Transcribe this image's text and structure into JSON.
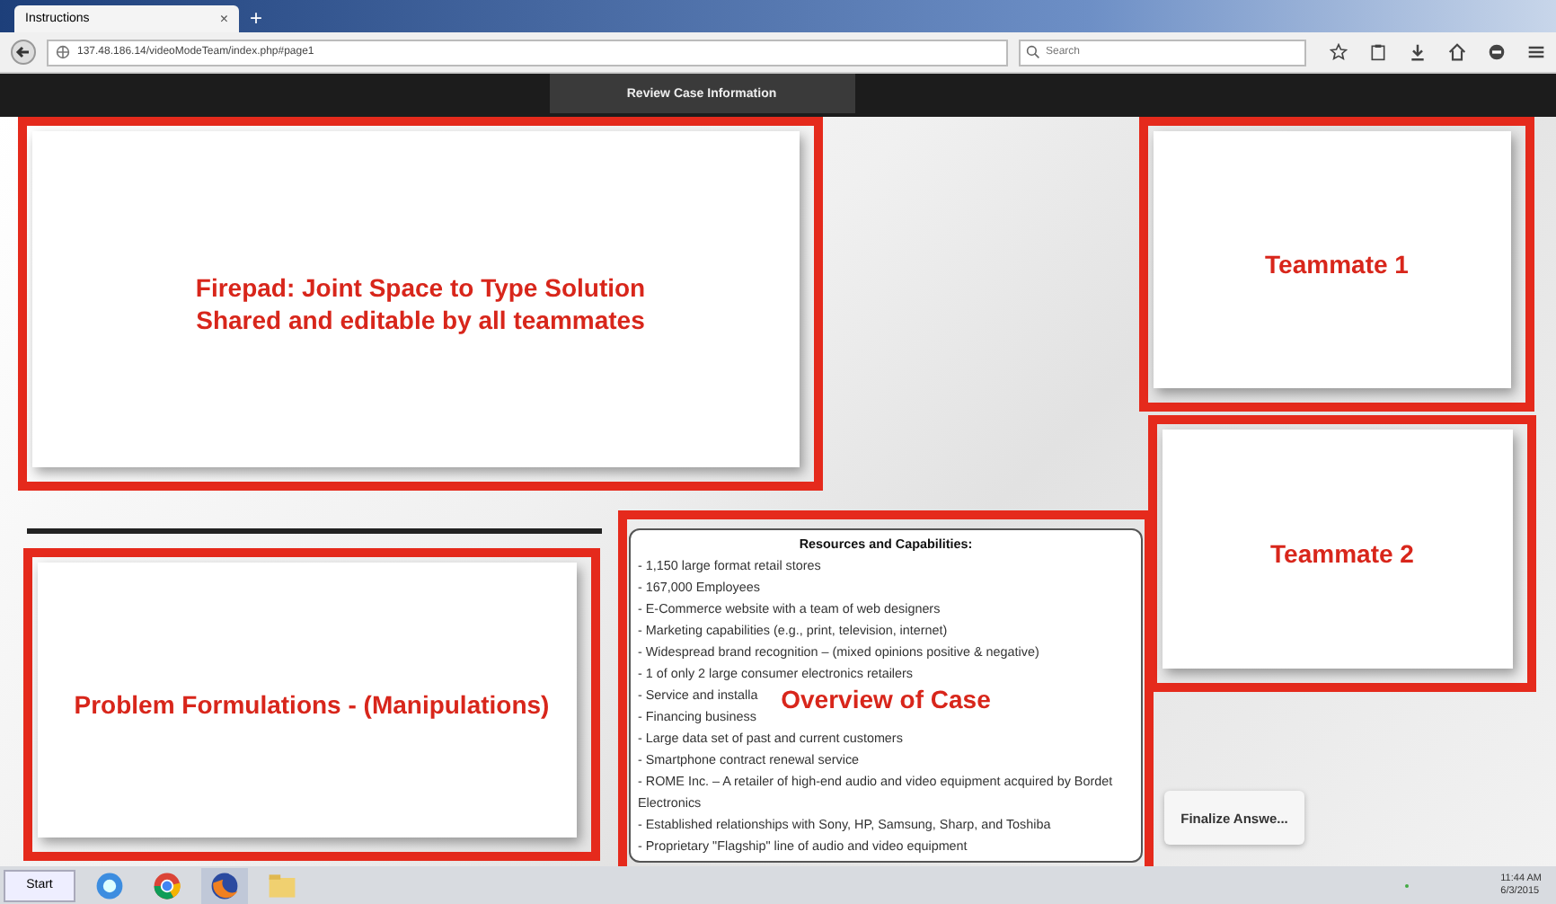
{
  "browser": {
    "tab": {
      "title": "Instructions",
      "close": "×"
    },
    "new_tab": "+",
    "url": "137.48.186.14/videoModeTeam/index.php#page1",
    "search": {
      "placeholder": "Search"
    }
  },
  "top_bar": {
    "button": "Review Case Information"
  },
  "overview": {
    "heading": "Resources and Capabilities:",
    "items": [
      "- 1,150 large format retail stores",
      "- 167,000 Employees",
      "- E-Commerce website with a team of web designers",
      "- Marketing capabilities (e.g., print, television, internet)",
      "- Widespread brand recognition – (mixed opinions positive & negative)",
      "- 1 of only 2 large consumer electronics retailers",
      "- Service and installa",
      "- Financing business",
      "- Large data set of past and current customers",
      "- Smartphone contract renewal service",
      "- ROME Inc. – A retailer of high-end audio and video equipment acquired by Bordet Electronics",
      "- Established relationships with Sony, HP, Samsung, Sharp, and Toshiba",
      "- Proprietary \"Flagship\" line of audio and video equipment"
    ]
  },
  "finalize_button": "Finalize Answe...",
  "annotations": [
    {
      "kind": "firepad",
      "lines": [
        "Firepad: Joint Space to Type Solution",
        "Shared and editable by all teammates"
      ]
    },
    {
      "kind": "teammate1",
      "lines": [
        "Teammate 1"
      ]
    },
    {
      "kind": "teammate2",
      "lines": [
        "Teammate 2"
      ]
    },
    {
      "kind": "problem",
      "lines": [
        "Problem Formulations - (Manipulations)"
      ]
    },
    {
      "kind": "overview",
      "lines": [
        "Overview of Case"
      ]
    }
  ],
  "taskbar": {
    "start": "Start",
    "clock": {
      "time": "11:44 AM",
      "date": "6/3/2015"
    }
  }
}
